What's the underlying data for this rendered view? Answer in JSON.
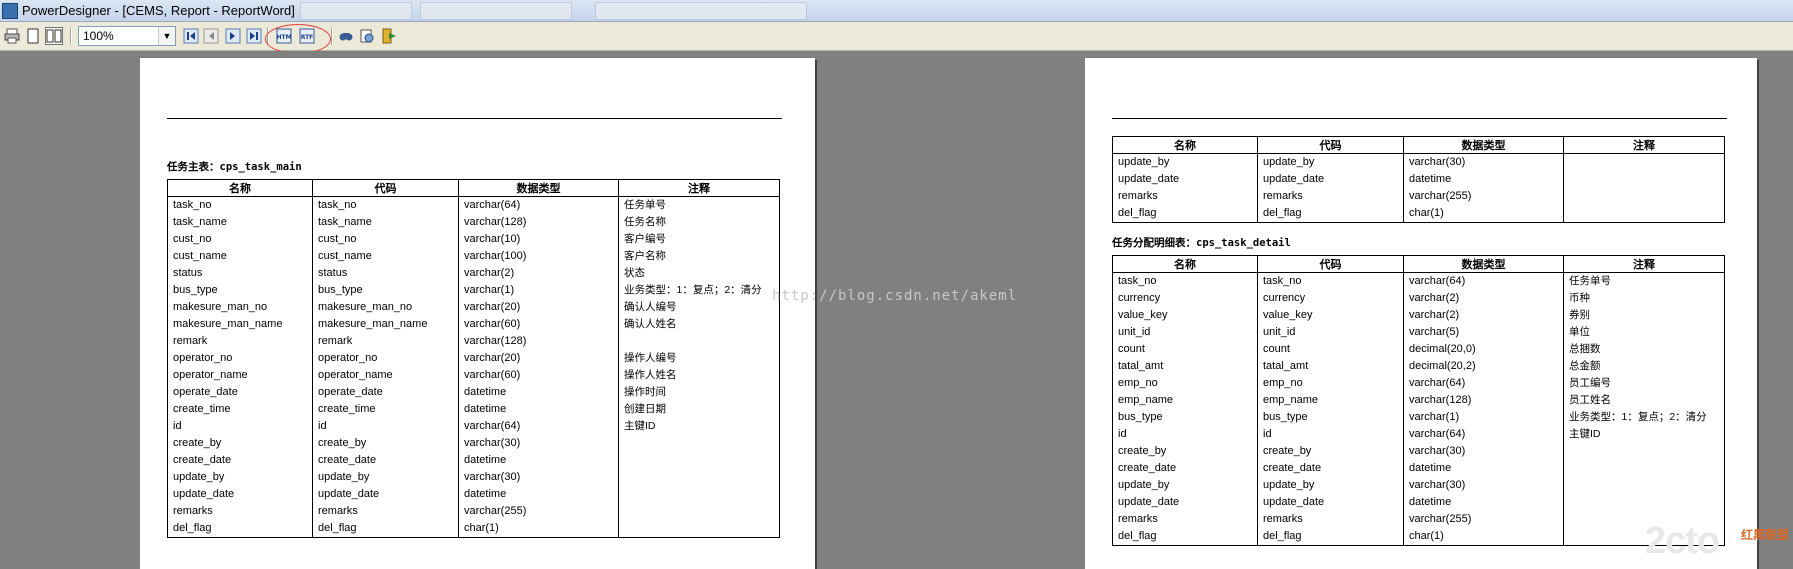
{
  "window": {
    "title": "PowerDesigner - [CEMS, Report - ReportWord]"
  },
  "toolbar": {
    "zoom_value": "100%",
    "buttons": [
      {
        "name": "print-icon"
      },
      {
        "name": "page-single-icon"
      },
      {
        "name": "page-two-icon"
      },
      {
        "name": "first-page-icon"
      },
      {
        "name": "prev-page-icon"
      },
      {
        "name": "next-page-icon"
      },
      {
        "name": "last-page-icon"
      },
      {
        "name": "export-html-icon",
        "label": "HTM"
      },
      {
        "name": "export-rtf-icon",
        "label": "RTF"
      },
      {
        "name": "find-icon"
      },
      {
        "name": "print-preview-icon"
      },
      {
        "name": "exit-icon"
      }
    ],
    "highlight_color": "#e04040"
  },
  "headers": [
    "名称",
    "代码",
    "数据类型",
    "注释"
  ],
  "watermark": "http://blog.csdn.net/akeml",
  "logo": {
    "text": "2cto",
    "suffix": "红黑联盟"
  },
  "left_page": {
    "table_title": "任务主表：cps_task_main",
    "rows": [
      [
        "task_no",
        "task_no",
        "varchar(64)",
        "任务单号"
      ],
      [
        "task_name",
        "task_name",
        "varchar(128)",
        "任务名称"
      ],
      [
        "cust_no",
        "cust_no",
        "varchar(10)",
        "客户编号"
      ],
      [
        "cust_name",
        "cust_name",
        "varchar(100)",
        "客户名称"
      ],
      [
        "status",
        "status",
        "varchar(2)",
        "状态"
      ],
      [
        "bus_type",
        "bus_type",
        "varchar(1)",
        "业务类型：1：复点；2：清分"
      ],
      [
        "makesure_man_no",
        "makesure_man_no",
        "varchar(20)",
        "确认人编号"
      ],
      [
        "makesure_man_name",
        "makesure_man_name",
        "varchar(60)",
        "确认人姓名"
      ],
      [
        "remark",
        "remark",
        "varchar(128)",
        ""
      ],
      [
        "operator_no",
        "operator_no",
        "varchar(20)",
        "操作人编号"
      ],
      [
        "operator_name",
        "operator_name",
        "varchar(60)",
        "操作人姓名"
      ],
      [
        "operate_date",
        "operate_date",
        "datetime",
        "操作时间"
      ],
      [
        "create_time",
        "create_time",
        "datetime",
        "创建日期"
      ],
      [
        "id",
        "id",
        "varchar(64)",
        "主键ID"
      ],
      [
        "create_by",
        "create_by",
        "varchar(30)",
        ""
      ],
      [
        "create_date",
        "create_date",
        "datetime",
        ""
      ],
      [
        "update_by",
        "update_by",
        "varchar(30)",
        ""
      ],
      [
        "update_date",
        "update_date",
        "datetime",
        ""
      ],
      [
        "remarks",
        "remarks",
        "varchar(255)",
        ""
      ],
      [
        "del_flag",
        "del_flag",
        "char(1)",
        ""
      ]
    ]
  },
  "right_page": {
    "cont_rows": [
      [
        "update_by",
        "update_by",
        "varchar(30)",
        ""
      ],
      [
        "update_date",
        "update_date",
        "datetime",
        ""
      ],
      [
        "remarks",
        "remarks",
        "varchar(255)",
        ""
      ],
      [
        "del_flag",
        "del_flag",
        "char(1)",
        ""
      ]
    ],
    "table_title": "任务分配明细表：cps_task_detail",
    "rows": [
      [
        "task_no",
        "task_no",
        "varchar(64)",
        "任务单号"
      ],
      [
        "currency",
        "currency",
        "varchar(2)",
        "币种"
      ],
      [
        "value_key",
        "value_key",
        "varchar(2)",
        "券别"
      ],
      [
        "unit_id",
        "unit_id",
        "varchar(5)",
        "单位"
      ],
      [
        "count",
        "count",
        "decimal(20,0)",
        "总捆数"
      ],
      [
        "tatal_amt",
        "tatal_amt",
        "decimal(20,2)",
        "总金额"
      ],
      [
        "emp_no",
        "emp_no",
        "varchar(64)",
        "员工编号"
      ],
      [
        "emp_name",
        "emp_name",
        "varchar(128)",
        "员工姓名"
      ],
      [
        "bus_type",
        "bus_type",
        "varchar(1)",
        "业务类型：1：复点；2：清分"
      ],
      [
        "id",
        "id",
        "varchar(64)",
        "主键ID"
      ],
      [
        "create_by",
        "create_by",
        "varchar(30)",
        ""
      ],
      [
        "create_date",
        "create_date",
        "datetime",
        ""
      ],
      [
        "update_by",
        "update_by",
        "varchar(30)",
        ""
      ],
      [
        "update_date",
        "update_date",
        "datetime",
        ""
      ],
      [
        "remarks",
        "remarks",
        "varchar(255)",
        ""
      ],
      [
        "del_flag",
        "del_flag",
        "char(1)",
        ""
      ]
    ]
  }
}
